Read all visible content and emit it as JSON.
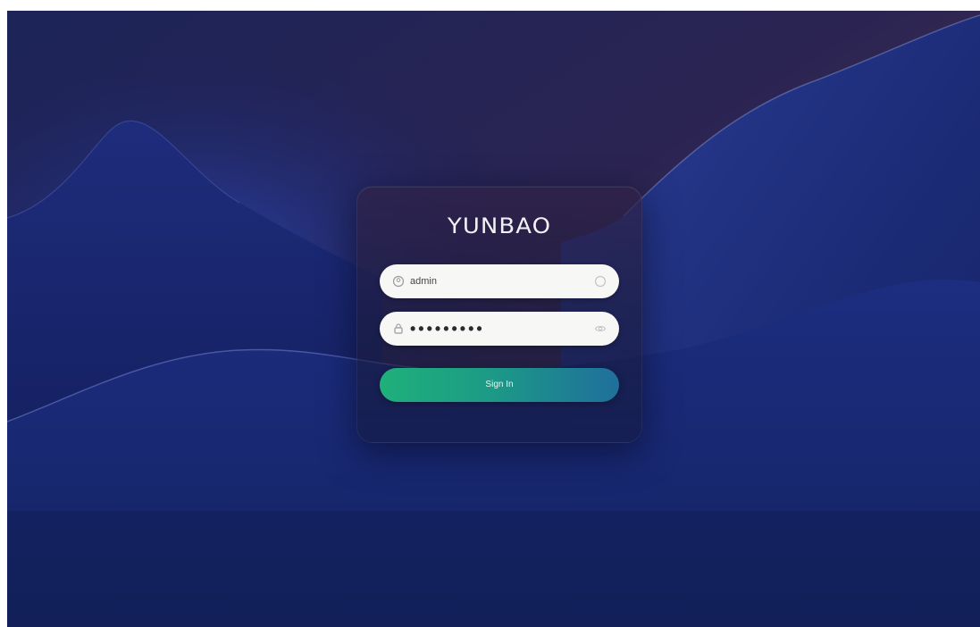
{
  "brand": {
    "logo_text": "YUNBAO"
  },
  "login": {
    "username_value": "admin",
    "password_value": "•••••••••",
    "username_icon": "user-icon",
    "password_icon": "lock-icon",
    "clear_icon": "clear-icon",
    "visibility_icon": "eye-icon",
    "submit_label": "Sign In"
  },
  "colors": {
    "button_start": "#1fb07a",
    "button_end": "#1f6f9c",
    "background_top": "#3a2a4e",
    "background_base": "#16246a"
  }
}
